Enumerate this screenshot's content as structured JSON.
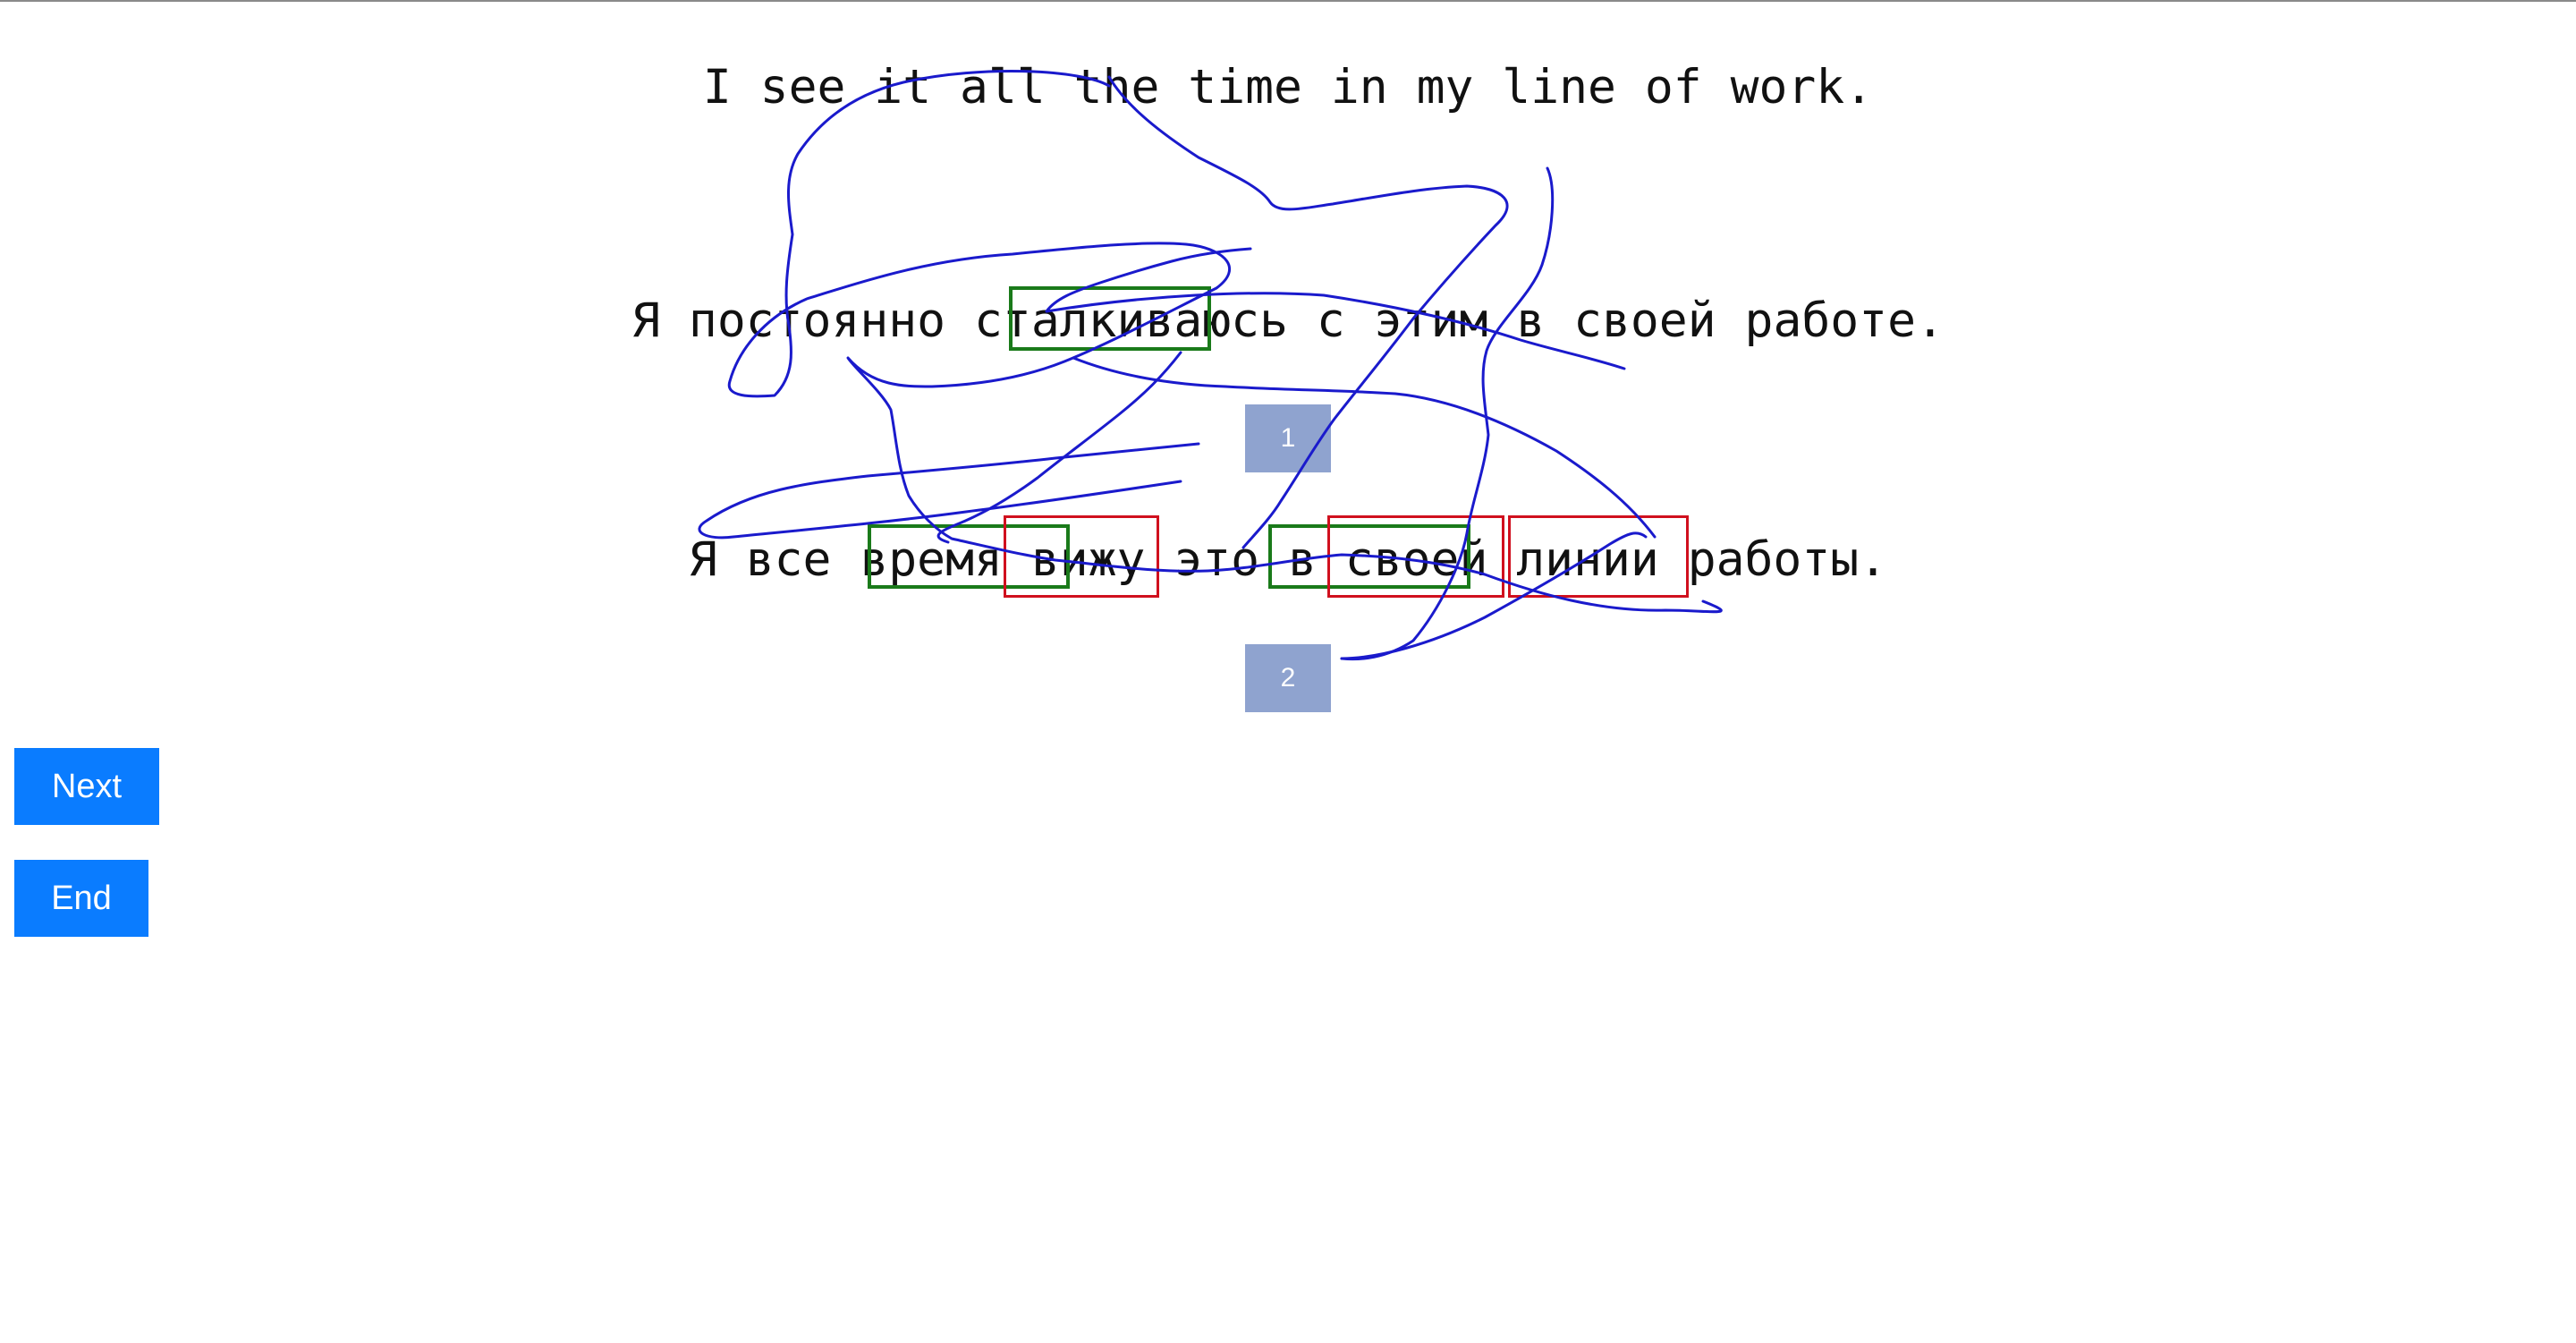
{
  "source_sentence": "I see it all the time in my line of work.",
  "reference_sentence": "Я постоянно сталкиваюсь с этим в своей работе.",
  "hypothesis_sentence": "Я все время вижу это в своей линии работы.",
  "scores": {
    "first": "1",
    "second": "2"
  },
  "buttons": {
    "next": "Next",
    "end": "End"
  },
  "colors": {
    "button": "#0a7cff",
    "score_box": "#8fa3cf",
    "match_box": "#1a7a1a",
    "error_box": "#d0101e",
    "scribble": "#1a1acc"
  }
}
